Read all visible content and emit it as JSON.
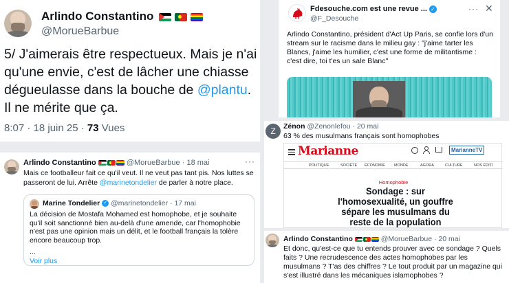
{
  "main_tweet": {
    "name": "Arlindo Constantino",
    "handle": "@MorueBarbue",
    "text_before": "5/ J'aimerais être respectueux. Mais je n'ai qu'une envie, c'est de lâcher une chiasse dégueulasse dans la bouche de ",
    "mention": "@plantu",
    "text_after": ". Il ne mérite que ça.",
    "time": "8:07 · 18 juin 25 · ",
    "views_count": "73",
    "views_label": " Vues"
  },
  "tweet_may18": {
    "name": "Arlindo Constantino",
    "handle": "@MorueBarbue",
    "date": "· 18 mai",
    "text_before": "Mais ce footballeur fait ce qu'il veut. Il ne veut pas tant pis. Nos luttes se passeront de lui. Arrête ",
    "mention": "@marinetondelier",
    "text_after": " de parler à notre place.",
    "quote": {
      "name": "Marine Tondelier",
      "handle": "@marinetondelier",
      "date": "· 17 mai",
      "text": "La décision de Mostafa Mohamed est homophobe, et je souhaite qu'il soit sanctionné bien au-delà d'une amende, car l'homophobie n'est pas une opinion mais un délit, et le football français la tolère encore beaucoup trop.",
      "ellipsis": "...",
      "see_more": "Voir plus"
    }
  },
  "fdesouche": {
    "name": "Fdesouche.com est une revue ...",
    "handle": "@F_Desouche",
    "text": "Arlindo Constantino, président d'Act Up Paris, se confie lors d'un stream sur le racisme dans le milieu gay : \"j'aime tarter les Blancs, j'aime les humilier, c'est une forme de militantisme : c'est dire, toi t'es un sale Blanc\""
  },
  "zenon": {
    "name": "Zénon",
    "handle": "@Zenonlefou",
    "date": "· 20 mai",
    "avatar_letter": "Z",
    "text": "63 % des musulmans français sont homophobes",
    "article": {
      "masthead": "Marianne",
      "tv": "MarianneTV",
      "nav": [
        "POLITIQUE",
        "SOCIÉTÉ",
        "ÉCONOMIE",
        "MONDE",
        "AGORA",
        "CULTURE",
        "NOS ÉDITI"
      ],
      "kicker": "Homophobie",
      "headline": "Sondage : sur l'homosexualité, un gouffre sépare les musulmans du reste de la population"
    }
  },
  "tweet_may20": {
    "name": "Arlindo Constantino",
    "handle": "@MorueBarbue",
    "date": "· 20 mai",
    "text": "Et donc, qu'est-ce que tu entends prouver avec ce sondage ? Quels faits ? Une recrudescence des actes homophobes par les musulmans ? T'as des chiffres ? Le tout produit par un magazine qui s'est illustré dans les mécaniques islamophobes ?"
  },
  "colors": {
    "link": "#1d9bf0",
    "text": "#0f1419",
    "muted": "#536471",
    "marianne_red": "#d50a1a"
  }
}
